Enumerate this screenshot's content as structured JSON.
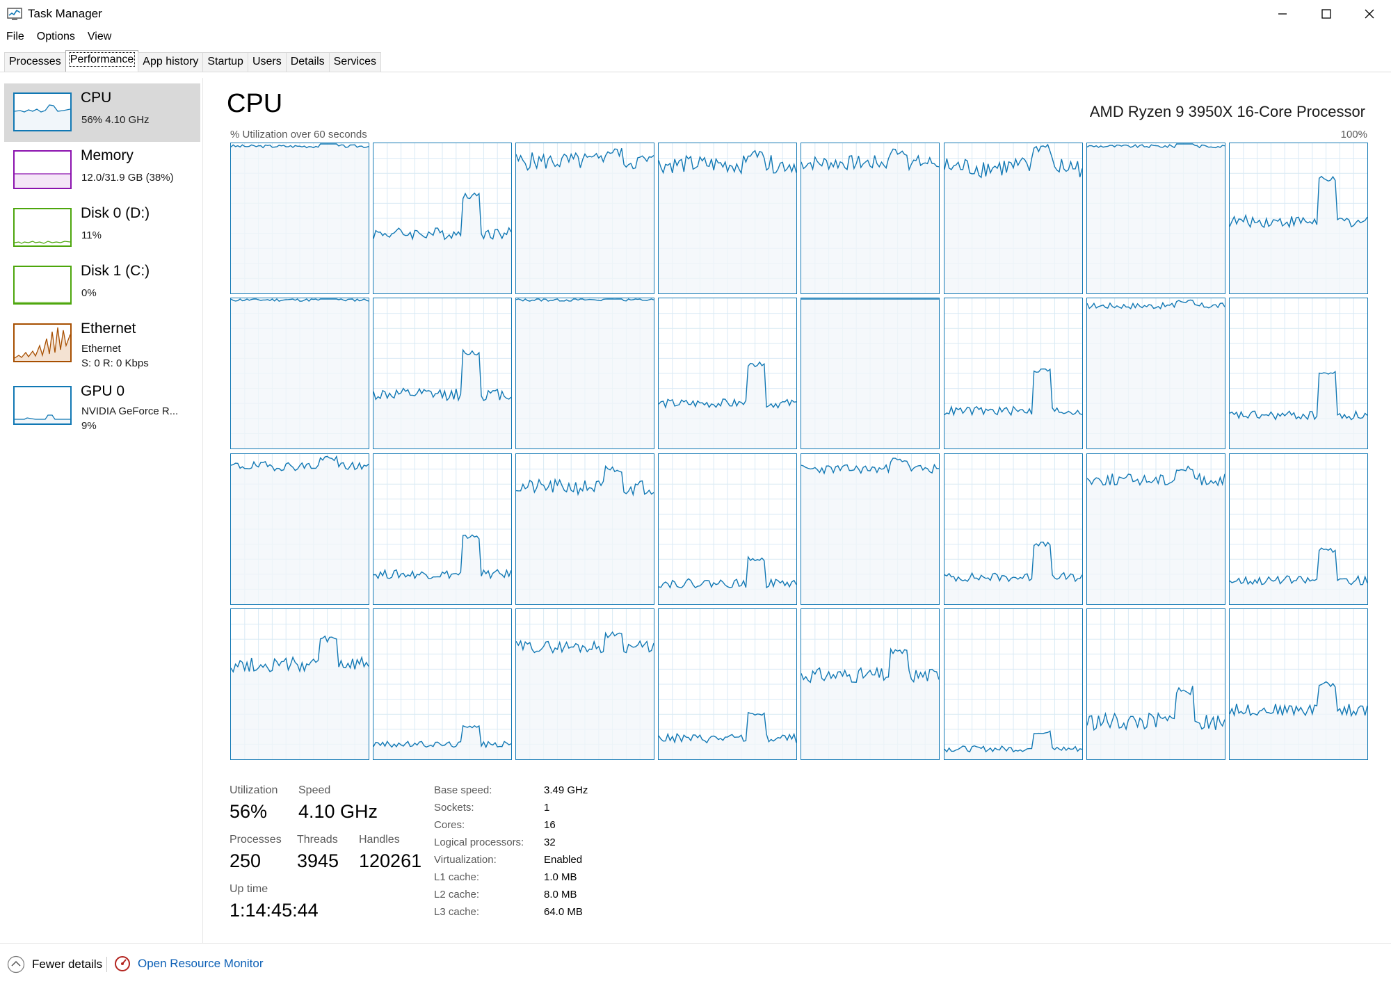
{
  "window": {
    "title": "Task Manager"
  },
  "menu": [
    "File",
    "Options",
    "View"
  ],
  "tabs": [
    {
      "label": "Processes"
    },
    {
      "label": "Performance",
      "active": true
    },
    {
      "label": "App history"
    },
    {
      "label": "Startup"
    },
    {
      "label": "Users"
    },
    {
      "label": "Details"
    },
    {
      "label": "Services"
    }
  ],
  "sidebar": {
    "items": [
      {
        "name": "CPU",
        "lines": [
          "56% 4.10 GHz"
        ],
        "color": "#1178b4",
        "selected": true
      },
      {
        "name": "Memory",
        "lines": [
          "12.0/31.9 GB (38%)"
        ],
        "color": "#8b12ae"
      },
      {
        "name": "Disk 0 (D:)",
        "lines": [
          "11%"
        ],
        "color": "#4da60c"
      },
      {
        "name": "Disk 1 (C:)",
        "lines": [
          "0%"
        ],
        "color": "#4da60c"
      },
      {
        "name": "Ethernet",
        "lines": [
          "Ethernet",
          "S: 0 R: 0 Kbps"
        ],
        "color": "#a74f01"
      },
      {
        "name": "GPU 0",
        "lines": [
          "NVIDIA GeForce R...",
          "9%"
        ],
        "color": "#1178b4"
      }
    ]
  },
  "main": {
    "title": "CPU",
    "model": "AMD Ryzen 9 3950X 16-Core Processor",
    "graph_label": "% Utilization over 60 seconds",
    "graph_max": "100%",
    "accent_color": "#1178b4",
    "fill_color": "#f1f6fa",
    "grid_color": "#d9eaf4"
  },
  "stats": {
    "utilization": {
      "label": "Utilization",
      "value": "56%"
    },
    "speed": {
      "label": "Speed",
      "value": "4.10 GHz"
    },
    "processes": {
      "label": "Processes",
      "value": "250"
    },
    "threads": {
      "label": "Threads",
      "value": "3945"
    },
    "handles": {
      "label": "Handles",
      "value": "120261"
    },
    "uptime": {
      "label": "Up time",
      "value": "1:14:45:44"
    }
  },
  "details": [
    {
      "key": "Base speed:",
      "value": "3.49 GHz"
    },
    {
      "key": "Sockets:",
      "value": "1"
    },
    {
      "key": "Cores:",
      "value": "16"
    },
    {
      "key": "Logical processors:",
      "value": "32"
    },
    {
      "key": "Virtualization:",
      "value": "Enabled"
    },
    {
      "key": "L1 cache:",
      "value": "1.0 MB"
    },
    {
      "key": "L2 cache:",
      "value": "8.0 MB"
    },
    {
      "key": "L3 cache:",
      "value": "64.0 MB"
    }
  ],
  "footer": {
    "fewer_details": "Fewer details",
    "resource_monitor": "Open Resource Monitor"
  },
  "chart_data": {
    "type": "line",
    "title": "CPU",
    "xlabel": "",
    "ylabel": "% Utilization over 60 seconds",
    "ylim": [
      0,
      100
    ],
    "note_levels": "approximate per-logical-processor utilization levels (baseline, peak) in percent",
    "series": [
      {
        "base": 98,
        "peak": 100,
        "noise": 1
      },
      {
        "base": 40,
        "peak": 65,
        "noise": 4
      },
      {
        "base": 88,
        "peak": 94,
        "noise": 6
      },
      {
        "base": 86,
        "peak": 93,
        "noise": 6
      },
      {
        "base": 87,
        "peak": 94,
        "noise": 5
      },
      {
        "base": 84,
        "peak": 97,
        "noise": 7
      },
      {
        "base": 98,
        "peak": 100,
        "noise": 1
      },
      {
        "base": 48,
        "peak": 76,
        "noise": 4
      },
      {
        "base": 99,
        "peak": 100,
        "noise": 1
      },
      {
        "base": 36,
        "peak": 64,
        "noise": 4
      },
      {
        "base": 99,
        "peak": 100,
        "noise": 1
      },
      {
        "base": 30,
        "peak": 56,
        "noise": 3
      },
      {
        "base": 100,
        "peak": 100,
        "noise": 0
      },
      {
        "base": 25,
        "peak": 52,
        "noise": 3
      },
      {
        "base": 95,
        "peak": 98,
        "noise": 2
      },
      {
        "base": 22,
        "peak": 50,
        "noise": 3
      },
      {
        "base": 92,
        "peak": 97,
        "noise": 3
      },
      {
        "base": 20,
        "peak": 45,
        "noise": 3
      },
      {
        "base": 78,
        "peak": 90,
        "noise": 5
      },
      {
        "base": 14,
        "peak": 30,
        "noise": 3
      },
      {
        "base": 90,
        "peak": 96,
        "noise": 3
      },
      {
        "base": 18,
        "peak": 40,
        "noise": 3
      },
      {
        "base": 83,
        "peak": 90,
        "noise": 4
      },
      {
        "base": 16,
        "peak": 36,
        "noise": 3
      },
      {
        "base": 63,
        "peak": 80,
        "noise": 5
      },
      {
        "base": 10,
        "peak": 22,
        "noise": 2
      },
      {
        "base": 75,
        "peak": 83,
        "noise": 4
      },
      {
        "base": 14,
        "peak": 30,
        "noise": 3
      },
      {
        "base": 56,
        "peak": 71,
        "noise": 5
      },
      {
        "base": 7,
        "peak": 18,
        "noise": 2
      },
      {
        "base": 25,
        "peak": 46,
        "noise": 6
      },
      {
        "base": 33,
        "peak": 50,
        "noise": 4
      }
    ]
  }
}
